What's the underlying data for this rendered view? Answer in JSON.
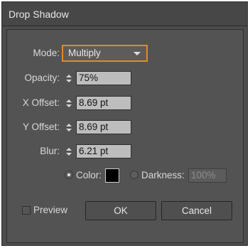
{
  "window": {
    "title": "Drop Shadow"
  },
  "mode": {
    "label": "Mode:",
    "value": "Multiply"
  },
  "opacity": {
    "label": "Opacity:",
    "value": "75%"
  },
  "x_offset": {
    "label": "X Offset:",
    "value": "8.69 pt"
  },
  "y_offset": {
    "label": "Y Offset:",
    "value": "8.69 pt"
  },
  "blur": {
    "label": "Blur:",
    "value": "6.21 pt"
  },
  "color_option": {
    "label": "Color:",
    "selected": true,
    "swatch_color": "#000000"
  },
  "darkness_option": {
    "label": "Darkness:",
    "value": "100%",
    "selected": false
  },
  "preview": {
    "label": "Preview",
    "checked": false
  },
  "buttons": {
    "ok": "OK",
    "cancel": "Cancel"
  },
  "colors": {
    "accent": "#e08a2d",
    "panel": "#535353",
    "field": "#bdbdbd"
  }
}
